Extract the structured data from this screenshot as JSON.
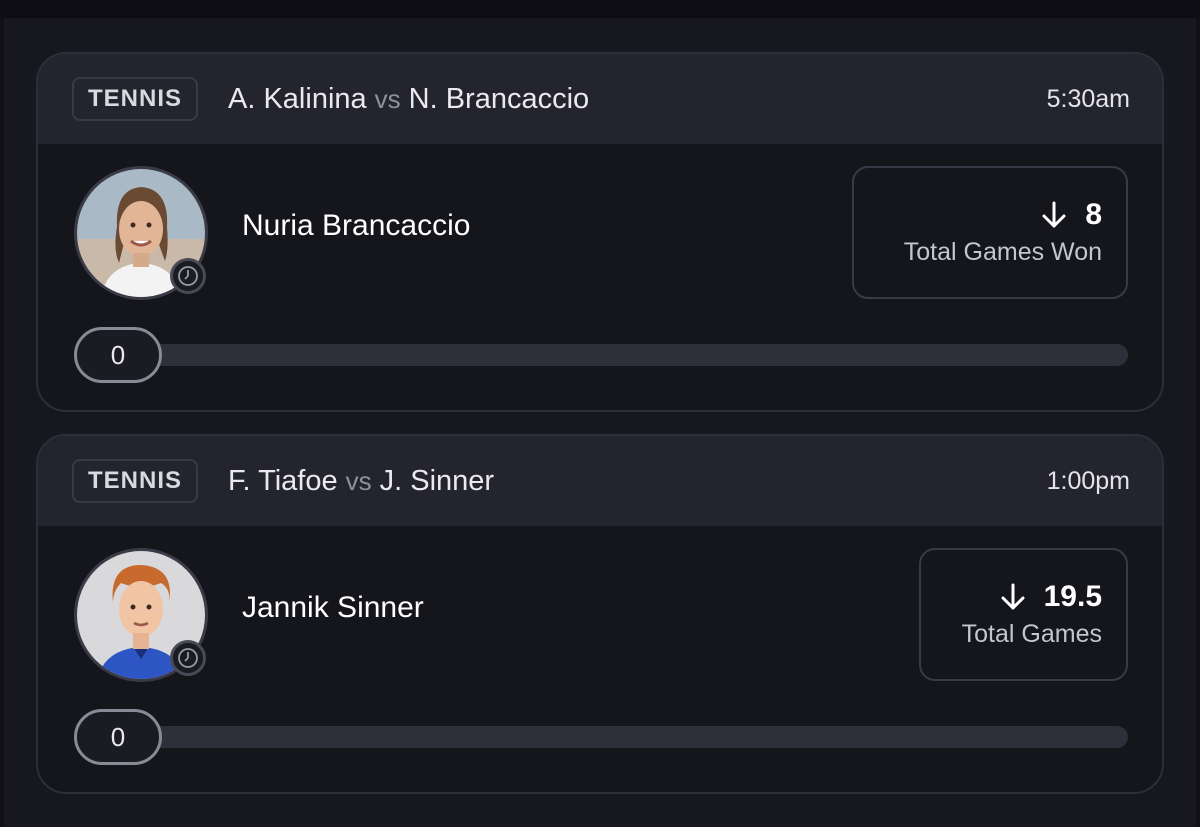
{
  "cards": [
    {
      "sport": "TENNIS",
      "player_a": "A. Kalinina",
      "vs": "vs",
      "player_b": "N. Brancaccio",
      "time": "5:30am",
      "selected_player": "Nuria Brancaccio",
      "direction_icon": "arrow-down-icon",
      "line": "8",
      "stat": "Total Games Won",
      "progress_value": "0",
      "progress_fraction": 0
    },
    {
      "sport": "TENNIS",
      "player_a": "F. Tiafoe",
      "vs": "vs",
      "player_b": "J. Sinner",
      "time": "1:00pm",
      "selected_player": "Jannik Sinner",
      "direction_icon": "arrow-down-icon",
      "line": "19.5",
      "stat": "Total Games",
      "progress_value": "0",
      "progress_fraction": 0
    }
  ]
}
